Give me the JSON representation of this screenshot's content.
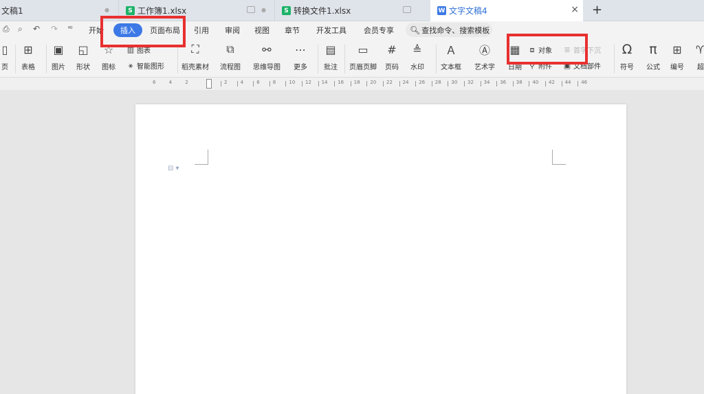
{
  "tabs": [
    {
      "label": "文稿1",
      "file_icon": ""
    },
    {
      "label": "工作簿1.xlsx",
      "file_icon": "S"
    },
    {
      "label": "转换文件1.xlsx",
      "file_icon": "S"
    },
    {
      "label": "文字文稿4",
      "file_icon": "W"
    }
  ],
  "tab_add": "+",
  "tab_close": "×",
  "menu": {
    "items": [
      "开始",
      "插入",
      "页面布局",
      "引用",
      "审阅",
      "视图",
      "章节",
      "开发工具",
      "会员专享"
    ],
    "active": "插入",
    "search_placeholder": "查找命令、搜索模板"
  },
  "ribbon": {
    "page_partial": "页",
    "table": "表格",
    "picture": "图片",
    "shape": "形状",
    "icon": "图标",
    "chart": "图表",
    "smart_art": "智能图形",
    "material": "稻壳素材",
    "flowchart": "流程图",
    "mindmap": "思维导图",
    "more": "更多",
    "comment": "批注",
    "header_footer": "页眉页脚",
    "page_number": "页码",
    "watermark": "水印",
    "textbox": "文本框",
    "wordart": "艺术字",
    "date": "日期",
    "object": "对象",
    "dropcap": "首字下沉",
    "attachment": "附件",
    "doc_parts": "文档部件",
    "symbol": "符号",
    "formula": "公式",
    "numbering": "编号",
    "hyperlink_partial": "超"
  },
  "ruler": {
    "left_labels": [
      "6",
      "4",
      "2"
    ],
    "labels": [
      "2",
      "4",
      "6",
      "8",
      "10",
      "12",
      "14",
      "16",
      "18",
      "20",
      "22",
      "24",
      "26",
      "28",
      "30",
      "32",
      "34",
      "36",
      "38",
      "40",
      "42",
      "44",
      "46"
    ]
  },
  "highlight_color": "#e8302f",
  "accent_color": "#3c79e6"
}
